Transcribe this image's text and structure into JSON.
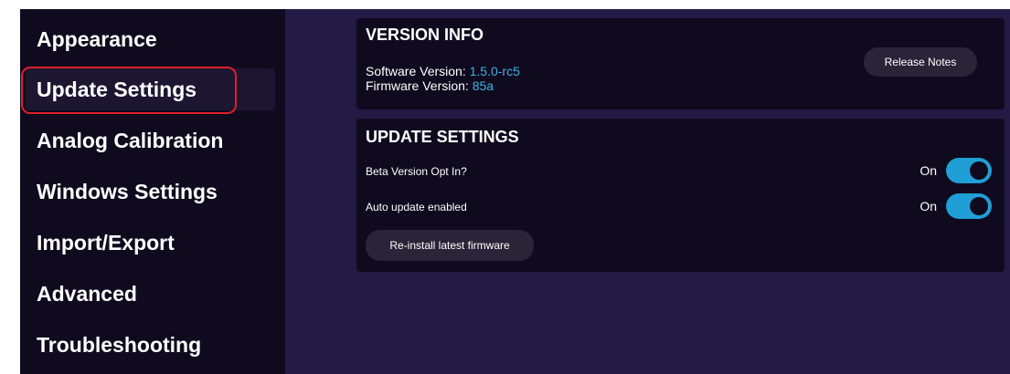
{
  "sidebar": {
    "items": [
      {
        "label": "Appearance"
      },
      {
        "label": "Update Settings"
      },
      {
        "label": "Analog Calibration"
      },
      {
        "label": "Windows Settings"
      },
      {
        "label": "Import/Export"
      },
      {
        "label": "Advanced"
      },
      {
        "label": "Troubleshooting"
      }
    ],
    "active_index": 1
  },
  "version_info": {
    "title": "VERSION INFO",
    "software_label": "Software Version:",
    "software_value": "1.5.0-rc5",
    "firmware_label": "Firmware Version:",
    "firmware_value": "85a",
    "release_notes_label": "Release Notes"
  },
  "update_settings": {
    "title": "UPDATE SETTINGS",
    "beta_label": "Beta Version Opt In?",
    "beta_state": "On",
    "auto_label": "Auto update enabled",
    "auto_state": "On",
    "reinstall_label": "Re-install latest firmware"
  },
  "colors": {
    "sidebar_bg": "#0f0a1e",
    "main_bg": "#231a45",
    "accent": "#1f9fd6",
    "value_text": "#3db3e6",
    "highlight_ring": "#e0202a"
  }
}
